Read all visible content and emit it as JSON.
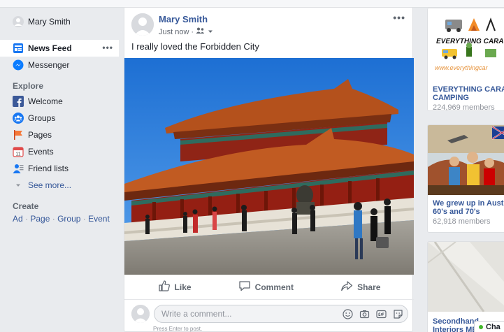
{
  "nav": {
    "profile_name": "Mary Smith",
    "news_feed": "News Feed",
    "news_feed_more": "•••",
    "messenger": "Messenger",
    "explore_title": "Explore",
    "explore_items": [
      "Welcome",
      "Groups",
      "Pages",
      "Events",
      "Friend lists"
    ],
    "see_more": "See more...",
    "create_title": "Create",
    "create_links": [
      "Ad",
      "Page",
      "Group",
      "Event"
    ],
    "create_sep": " · "
  },
  "post": {
    "author": "Mary Smith",
    "time": "Just now",
    "dot": "·",
    "menu": "•••",
    "text": "I really loved the Forbidden City",
    "actions": {
      "like": "Like",
      "comment": "Comment",
      "share": "Share"
    },
    "comment_placeholder": "Write a comment...",
    "hint": "Press Enter to post."
  },
  "groups": [
    {
      "banner_line1": "EVERYTHING CARA",
      "banner_url": "www.everythingcar",
      "name_line1": "EVERYTHING CARAV",
      "name_line2": "CAMPING",
      "members": "224,969 members"
    },
    {
      "name_line1": "We grew up in Austral",
      "name_line2": "60's and 70's",
      "members": "62,918 members"
    },
    {
      "name_line1": "Secondhand",
      "name_line2": "Interiors MEI"
    }
  ],
  "chat": {
    "label": "Cha"
  },
  "colors": {
    "link": "#365899",
    "background": "#e9ebee",
    "online": "#42b72a"
  }
}
